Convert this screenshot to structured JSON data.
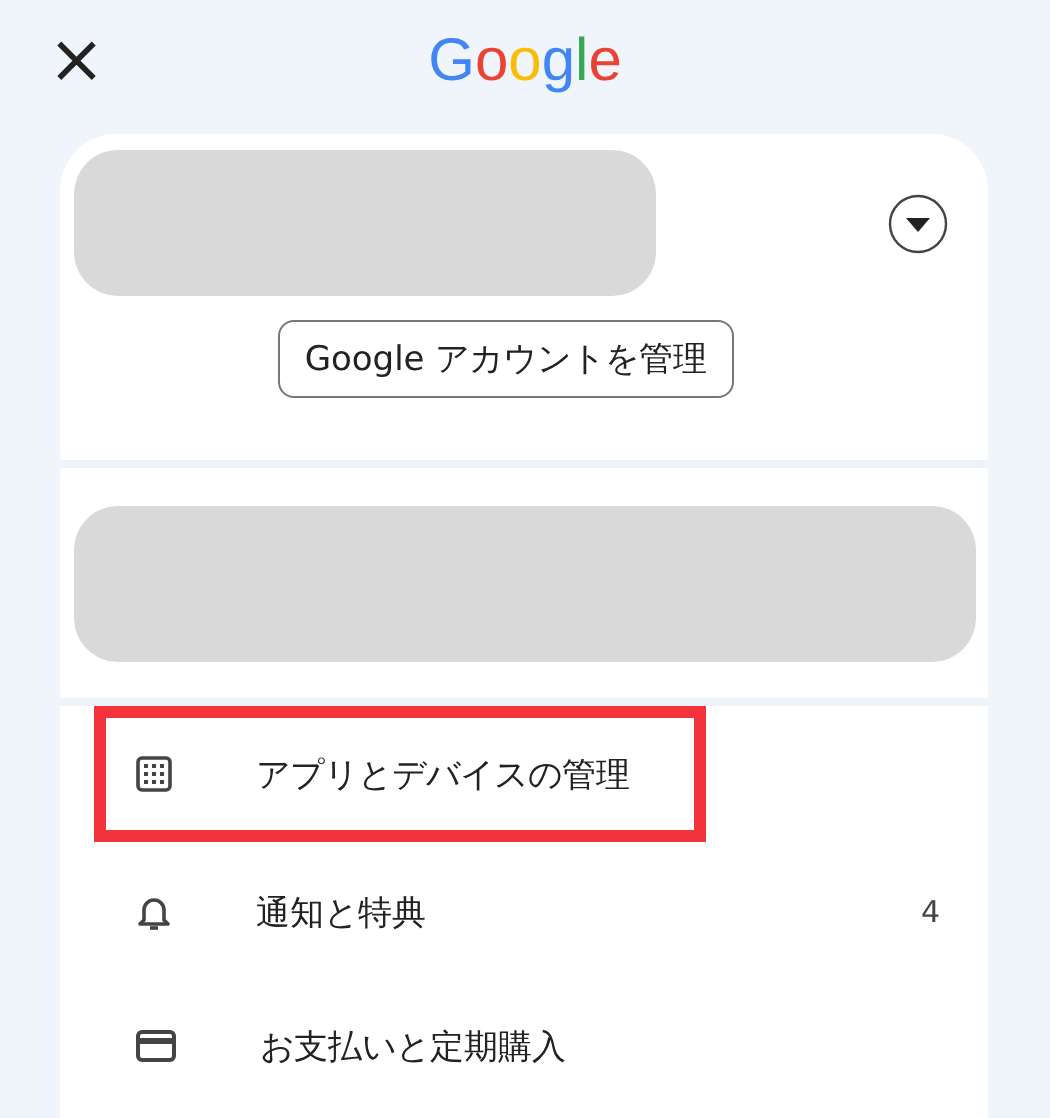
{
  "header": {
    "close": "×",
    "logo": "Google"
  },
  "account": {
    "manage_button": "Google アカウントを管理",
    "expanded": false
  },
  "menu": [
    {
      "kind": "apps",
      "label": "アプリとデバイスの管理",
      "highlighted": true
    },
    {
      "kind": "bell",
      "label": "通知と特典",
      "count": "4",
      "highlighted": false
    },
    {
      "kind": "card",
      "label": "お支払いと定期購入",
      "highlighted": false
    }
  ]
}
